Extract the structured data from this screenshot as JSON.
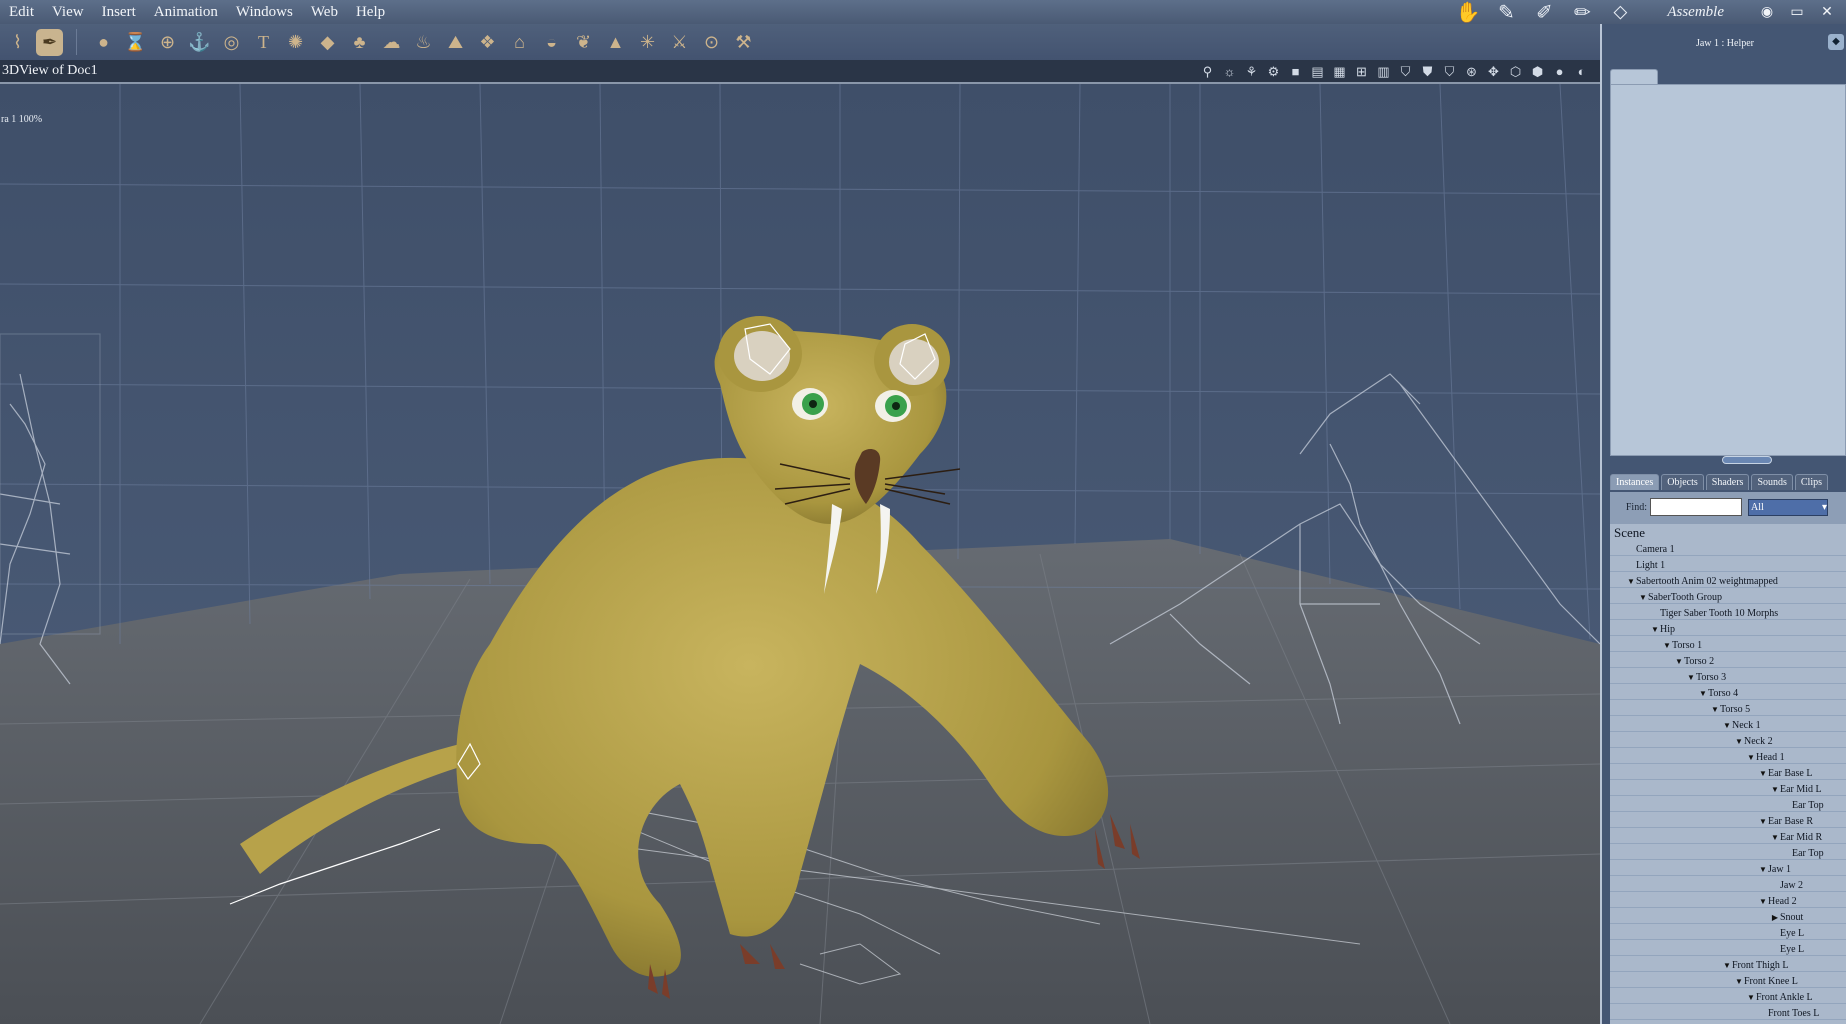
{
  "menu": [
    "Edit",
    "View",
    "Insert",
    "Animation",
    "Windows",
    "Web",
    "Help"
  ],
  "room_label": "Assemble",
  "viewport_title": "3DView of Doc1",
  "camera_label": "ra 1 100%",
  "helper_title": "Jaw 1 : Helper",
  "tabs": [
    "Instances",
    "Objects",
    "Shaders",
    "Sounds",
    "Clips"
  ],
  "find_label": "Find:",
  "find_value": "",
  "filter_value": "All",
  "tree": [
    {
      "label": "Scene",
      "depth": 0,
      "root": true
    },
    {
      "label": "Camera 1",
      "depth": 1
    },
    {
      "label": "Light 1",
      "depth": 1
    },
    {
      "label": "Sabertooth Anim 02 weightmapped",
      "depth": 1,
      "open": true
    },
    {
      "label": "SaberTooth Group",
      "depth": 2,
      "open": true
    },
    {
      "label": "Tiger Saber Tooth 10 Morphs",
      "depth": 3
    },
    {
      "label": "Hip",
      "depth": 3,
      "open": true
    },
    {
      "label": "Torso 1",
      "depth": 4,
      "open": true
    },
    {
      "label": "Torso 2",
      "depth": 5,
      "open": true
    },
    {
      "label": "Torso 3",
      "depth": 6,
      "open": true
    },
    {
      "label": "Torso 4",
      "depth": 7,
      "open": true
    },
    {
      "label": "Torso 5",
      "depth": 8,
      "open": true
    },
    {
      "label": "Neck 1",
      "depth": 9,
      "open": true
    },
    {
      "label": "Neck 2",
      "depth": 10,
      "open": true
    },
    {
      "label": "Head 1",
      "depth": 11,
      "open": true
    },
    {
      "label": "Ear Base L",
      "depth": 12,
      "open": true
    },
    {
      "label": "Ear Mid L",
      "depth": 13,
      "open": true
    },
    {
      "label": "Ear Top",
      "depth": 14
    },
    {
      "label": "Ear Base R",
      "depth": 12,
      "open": true
    },
    {
      "label": "Ear Mid R",
      "depth": 13,
      "open": true
    },
    {
      "label": "Ear Top",
      "depth": 14
    },
    {
      "label": "Jaw 1",
      "depth": 12,
      "open": true
    },
    {
      "label": "Jaw 2",
      "depth": 13
    },
    {
      "label": "Head 2",
      "depth": 12,
      "open": true
    },
    {
      "label": "Snout",
      "depth": 13,
      "closed": true
    },
    {
      "label": "Eye L",
      "depth": 13
    },
    {
      "label": "Eye L",
      "depth": 13
    },
    {
      "label": "Front Thigh L",
      "depth": 9,
      "open": true
    },
    {
      "label": "Front Knee L",
      "depth": 10,
      "open": true
    },
    {
      "label": "Front Ankle L",
      "depth": 11,
      "open": true
    },
    {
      "label": "Front Toes L",
      "depth": 12
    }
  ]
}
